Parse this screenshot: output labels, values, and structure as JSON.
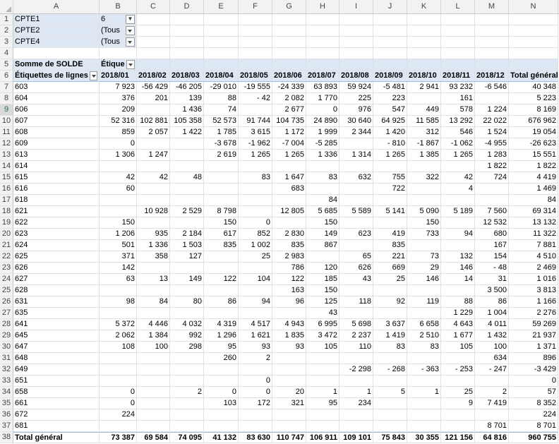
{
  "columns": [
    "A",
    "B",
    "C",
    "D",
    "E",
    "F",
    "G",
    "H",
    "I",
    "J",
    "K",
    "L",
    "M",
    "N"
  ],
  "filters": [
    {
      "row": "1",
      "label": "CPTE1",
      "value": "6"
    },
    {
      "row": "2",
      "label": "CPTE2",
      "value": "(Tous"
    },
    {
      "row": "3",
      "label": "CPTE4",
      "value": "(Tous"
    }
  ],
  "row4": "4",
  "pivot": {
    "row5_num": "5",
    "sum_label": "Somme de SOLDE",
    "col_labels_caption": "Étique",
    "row6_num": "6",
    "row_labels_caption": "Étiquettes de lignes",
    "months": [
      "2018/01",
      "2018/02",
      "2018/03",
      "2018/04",
      "2018/05",
      "2018/06",
      "2018/07",
      "2018/08",
      "2018/09",
      "2018/10",
      "2018/11",
      "2018/12"
    ],
    "grand_total_header": "Total général"
  },
  "rows": [
    {
      "n": "7",
      "label": "603",
      "vals": [
        "7 923",
        "-56 429",
        "-46 205",
        "-29 010",
        "-19 555",
        "-24 339",
        "63 893",
        "59 924",
        "-5 481",
        "2 941",
        "93 232",
        "-6 546",
        "40 348"
      ]
    },
    {
      "n": "8",
      "label": "604",
      "vals": [
        "376",
        "201",
        "139",
        "88",
        "- 42",
        "2 082",
        "1 770",
        "225",
        "223",
        "",
        "161",
        "",
        "5 223"
      ]
    },
    {
      "n": "9",
      "label": "606",
      "vals": [
        "209",
        "",
        "1 436",
        "74",
        "",
        "2 677",
        "0",
        "976",
        "547",
        "449",
        "578",
        "1 224",
        "8 169"
      ]
    },
    {
      "n": "10",
      "label": "607",
      "vals": [
        "52 316",
        "102 881",
        "105 358",
        "52 573",
        "91 744",
        "104 735",
        "24 890",
        "30 640",
        "64 925",
        "11 585",
        "13 292",
        "22 022",
        "676 962"
      ]
    },
    {
      "n": "11",
      "label": "608",
      "vals": [
        "859",
        "2 057",
        "1 422",
        "1 785",
        "3 615",
        "1 172",
        "1 999",
        "2 344",
        "1 420",
        "312",
        "546",
        "1 524",
        "19 054"
      ]
    },
    {
      "n": "12",
      "label": "609",
      "vals": [
        "0",
        "",
        "",
        "-3 678",
        "-1 962",
        "-7 004",
        "-5 285",
        "",
        "- 810",
        "-1 867",
        "-1 062",
        "-4 955",
        "-26 623"
      ]
    },
    {
      "n": "13",
      "label": "613",
      "vals": [
        "1 306",
        "1 247",
        "",
        "2 619",
        "1 265",
        "1 265",
        "1 336",
        "1 314",
        "1 265",
        "1 385",
        "1 265",
        "1 283",
        "15 551"
      ]
    },
    {
      "n": "14",
      "label": "614",
      "vals": [
        "",
        "",
        "",
        "",
        "",
        "",
        "",
        "",
        "",
        "",
        "",
        "1 822",
        "1 822"
      ]
    },
    {
      "n": "15",
      "label": "615",
      "vals": [
        "42",
        "42",
        "48",
        "",
        "83",
        "1 647",
        "83",
        "632",
        "755",
        "322",
        "42",
        "724",
        "4 419"
      ]
    },
    {
      "n": "16",
      "label": "616",
      "vals": [
        "60",
        "",
        "",
        "",
        "",
        "683",
        "",
        "",
        "722",
        "",
        "4",
        "",
        "1 469"
      ]
    },
    {
      "n": "17",
      "label": "618",
      "vals": [
        "",
        "",
        "",
        "",
        "",
        "",
        "84",
        "",
        "",
        "",
        "",
        "",
        "84"
      ]
    },
    {
      "n": "18",
      "label": "621",
      "vals": [
        "",
        "10 928",
        "2 529",
        "8 798",
        "",
        "12 805",
        "5 685",
        "5 589",
        "5 141",
        "5 090",
        "5 189",
        "7 560",
        "69 314"
      ]
    },
    {
      "n": "19",
      "label": "622",
      "vals": [
        "150",
        "",
        "",
        "150",
        "0",
        "",
        "150",
        "",
        "",
        "150",
        "",
        "12 532",
        "13 132"
      ]
    },
    {
      "n": "20",
      "label": "623",
      "vals": [
        "1 206",
        "935",
        "2 184",
        "617",
        "852",
        "2 830",
        "149",
        "623",
        "419",
        "733",
        "94",
        "680",
        "11 322"
      ]
    },
    {
      "n": "21",
      "label": "624",
      "vals": [
        "501",
        "1 336",
        "1 503",
        "835",
        "1 002",
        "835",
        "867",
        "",
        "835",
        "",
        "",
        "167",
        "7 881"
      ]
    },
    {
      "n": "22",
      "label": "625",
      "vals": [
        "371",
        "358",
        "127",
        "",
        "25",
        "2 983",
        "",
        "65",
        "221",
        "73",
        "132",
        "154",
        "4 510"
      ]
    },
    {
      "n": "23",
      "label": "626",
      "vals": [
        "142",
        "",
        "",
        "",
        "",
        "786",
        "120",
        "626",
        "669",
        "29",
        "146",
        "- 48",
        "2 469"
      ]
    },
    {
      "n": "24",
      "label": "627",
      "vals": [
        "63",
        "13",
        "149",
        "122",
        "104",
        "122",
        "185",
        "43",
        "25",
        "146",
        "14",
        "31",
        "1 016"
      ]
    },
    {
      "n": "25",
      "label": "628",
      "vals": [
        "",
        "",
        "",
        "",
        "",
        "163",
        "150",
        "",
        "",
        "",
        "",
        "3 500",
        "3 813"
      ]
    },
    {
      "n": "26",
      "label": "631",
      "vals": [
        "98",
        "84",
        "80",
        "86",
        "94",
        "96",
        "125",
        "118",
        "92",
        "119",
        "88",
        "86",
        "1 166"
      ]
    },
    {
      "n": "27",
      "label": "635",
      "vals": [
        "",
        "",
        "",
        "",
        "",
        "",
        "43",
        "",
        "",
        "",
        "1 229",
        "1 004",
        "2 276"
      ]
    },
    {
      "n": "28",
      "label": "641",
      "vals": [
        "5 372",
        "4 446",
        "4 032",
        "4 319",
        "4 517",
        "4 943",
        "6 995",
        "5 698",
        "3 637",
        "6 658",
        "4 643",
        "4 011",
        "59 269"
      ]
    },
    {
      "n": "29",
      "label": "645",
      "vals": [
        "2 062",
        "1 384",
        "992",
        "1 296",
        "1 621",
        "1 835",
        "3 472",
        "2 237",
        "1 419",
        "2 510",
        "1 677",
        "1 432",
        "21 937"
      ]
    },
    {
      "n": "30",
      "label": "647",
      "vals": [
        "108",
        "100",
        "298",
        "95",
        "93",
        "93",
        "105",
        "110",
        "83",
        "83",
        "105",
        "100",
        "1 371"
      ]
    },
    {
      "n": "31",
      "label": "648",
      "vals": [
        "",
        "",
        "",
        "260",
        "2",
        "",
        "",
        "",
        "",
        "",
        "",
        "634",
        "896"
      ]
    },
    {
      "n": "32",
      "label": "649",
      "vals": [
        "",
        "",
        "",
        "",
        "",
        "",
        "",
        "-2 298",
        "- 268",
        "- 363",
        "- 253",
        "- 247",
        "-3 429"
      ]
    },
    {
      "n": "33",
      "label": "651",
      "vals": [
        "",
        "",
        "",
        "",
        "0",
        "",
        "",
        "",
        "",
        "",
        "",
        "",
        "0"
      ]
    },
    {
      "n": "34",
      "label": "658",
      "vals": [
        "0",
        "",
        "2",
        "0",
        "0",
        "20",
        "1",
        "1",
        "5",
        "1",
        "25",
        "2",
        "57"
      ]
    },
    {
      "n": "35",
      "label": "661",
      "vals": [
        "0",
        "",
        "",
        "103",
        "172",
        "321",
        "95",
        "234",
        "",
        "",
        "9",
        "7 419",
        "8 352"
      ]
    },
    {
      "n": "36",
      "label": "672",
      "vals": [
        "224",
        "",
        "",
        "",
        "",
        "",
        "",
        "",
        "",
        "",
        "",
        "",
        "224"
      ]
    },
    {
      "n": "37",
      "label": "681",
      "vals": [
        "",
        "",
        "",
        "",
        "",
        "",
        "",
        "",
        "",
        "",
        "",
        "8 701",
        "8 701"
      ]
    }
  ],
  "total": {
    "n": "38",
    "label": "Total général",
    "vals": [
      "73 387",
      "69 584",
      "74 095",
      "41 132",
      "83 630",
      "110 747",
      "106 911",
      "109 101",
      "75 843",
      "30 355",
      "121 156",
      "64 816",
      "960 755"
    ]
  },
  "selected_row": "9"
}
